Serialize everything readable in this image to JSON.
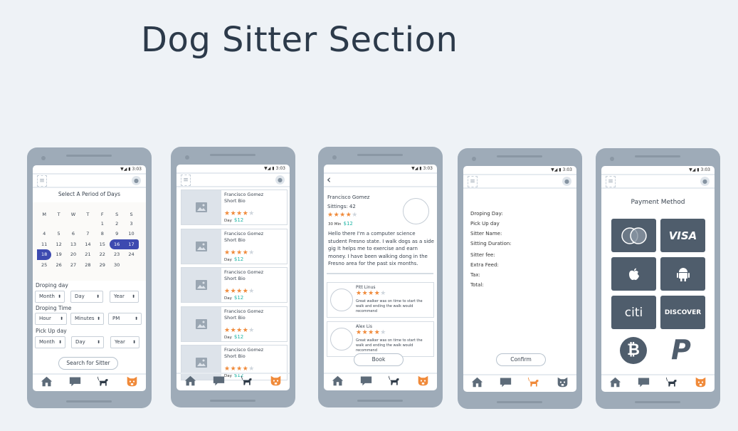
{
  "page_title": "Dog Sitter Section",
  "status_time": "3:03",
  "colors": {
    "accent_orange": "#f08a3a",
    "selected_blue": "#3d4ab0",
    "price_teal": "#1fb5a5",
    "tile": "#4f5d6c"
  },
  "screen1": {
    "heading": "Select A Period of Days",
    "weekdays": [
      "M",
      "T",
      "W",
      "T",
      "F",
      "S",
      "S"
    ],
    "days": [
      "",
      "",
      "",
      "",
      "1",
      "2",
      "3",
      "4",
      "5",
      "6",
      "7",
      "8",
      "9",
      "10",
      "11",
      "12",
      "13",
      "14",
      "15",
      "16",
      "17",
      "18",
      "19",
      "20",
      "21",
      "22",
      "23",
      "24",
      "25",
      "26",
      "27",
      "28",
      "29",
      "30"
    ],
    "selected": [
      "16",
      "17",
      "18"
    ],
    "droping_day_label": "Droping day",
    "droping_time_label": "Droping Time",
    "pickup_day_label": "Pick Up day",
    "month": "Month",
    "day": "Day",
    "year": "Year",
    "hour": "Hour",
    "minutes": "Minutes",
    "ampm": "PM",
    "search_button": "Search for Sitter"
  },
  "screen2": {
    "items": [
      {
        "name": "Francisco Gomez",
        "bio": "Short Bio",
        "unit": "Day",
        "price": "$12"
      },
      {
        "name": "Francisco Gomez",
        "bio": "Short Bio",
        "unit": "Day",
        "price": "$12"
      },
      {
        "name": "Francisco Gomez",
        "bio": "Short Bio",
        "unit": "Day",
        "price": "$12"
      },
      {
        "name": "Francisco Gomez",
        "bio": "Short Bio",
        "unit": "Day",
        "price": "$12"
      },
      {
        "name": "Francisco Gomez",
        "bio": "Short Bio",
        "unit": "Day",
        "price": "$12"
      }
    ],
    "rating": 4
  },
  "screen3": {
    "name": "Francisco Gomez",
    "sittings": "Sittings: 42",
    "unit": "30 Min",
    "price": "$12",
    "rating": 4,
    "bio": "Hello there I'm a computer science student Fresno state. I walk dogs as a side gig It helps me to exercise and earn money. I have been walking dong in the Fresno area for the past six months.",
    "reviews": [
      {
        "name": "Pitt Linus",
        "text": "Great walker was on time to start the walk and ending the walk would recommend",
        "rating": 4
      },
      {
        "name": "Alex Lis",
        "text": "Great walker was on time to start the walk and ending the walk would recommend",
        "rating": 4
      }
    ],
    "book_button": "Book"
  },
  "screen4": {
    "fields": [
      "Droping Day:",
      "Pick Up day",
      "Sitter Name:",
      "Sitting Duration:",
      "Sitter fee:",
      "Extra Feed:",
      "Tax:",
      "Total:"
    ],
    "confirm_button": "Confirm"
  },
  "screen5": {
    "heading": "Payment Method",
    "methods": [
      "Mastercard",
      "VISA",
      "Apple Pay",
      "Android Pay",
      "citi",
      "DISCOVER",
      "Bitcoin",
      "PayPal"
    ]
  }
}
